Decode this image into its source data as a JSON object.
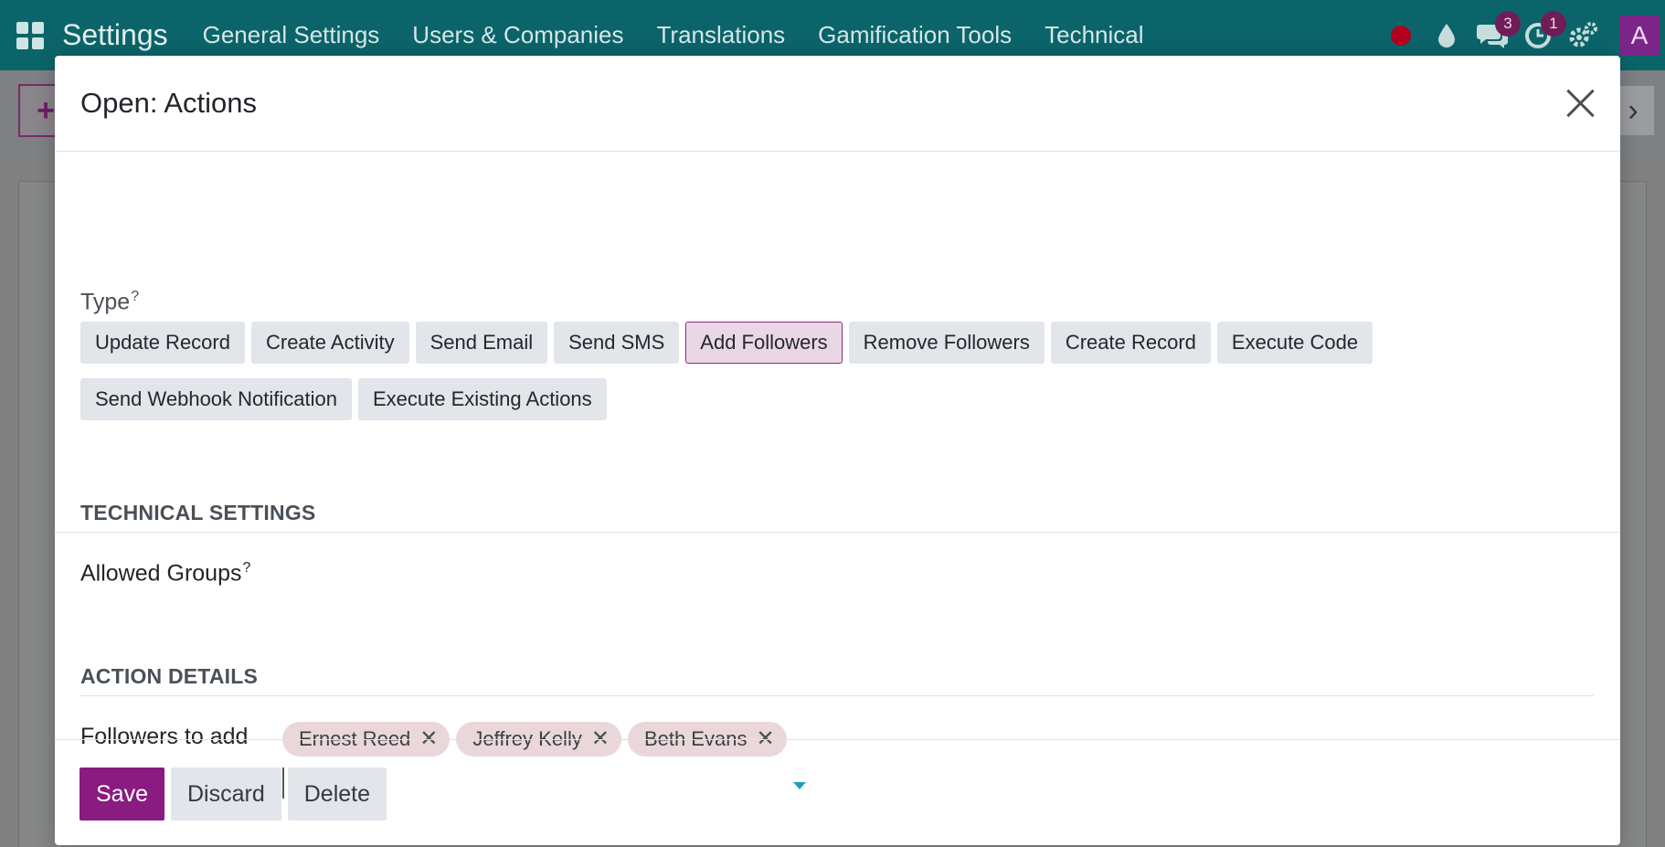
{
  "navbar": {
    "app_title": "Settings",
    "menu": [
      "General Settings",
      "Users & Companies",
      "Translations",
      "Gamification Tools",
      "Technical"
    ],
    "messages_count": "3",
    "activities_count": "1",
    "avatar_letter": "A",
    "icons": [
      "apps-grid-icon",
      "record-dot-icon",
      "droplet-icon",
      "chat-icon",
      "clock-icon",
      "settings-icon"
    ]
  },
  "modal": {
    "title": "Open: Actions",
    "type_label": "Type",
    "type_help": "?",
    "type_options_row1": [
      "Update Record",
      "Create Activity",
      "Send Email",
      "Send SMS",
      "Add Followers",
      "Remove Followers",
      "Create Record",
      "Execute Code"
    ],
    "type_options_row2": [
      "Send Webhook Notification",
      "Execute Existing Actions"
    ],
    "selected_type": "Add Followers",
    "technical_settings_title": "TECHNICAL SETTINGS",
    "allowed_groups_label": "Allowed Groups",
    "allowed_groups_help": "?",
    "action_details_title": "ACTION DETAILS",
    "followers_label": "Followers to add",
    "followers": [
      "Ernest Reed",
      "Jeffrey Kelly",
      "Beth Evans"
    ],
    "followers_input_value": "",
    "footer": {
      "save": "Save",
      "discard": "Discard",
      "delete": "Delete"
    }
  },
  "colors": {
    "navbar_bg": "#0b6469",
    "primary": "#8a1b80",
    "selected_option_bg": "#ead7e6",
    "tag_bg": "#ead7d9"
  }
}
